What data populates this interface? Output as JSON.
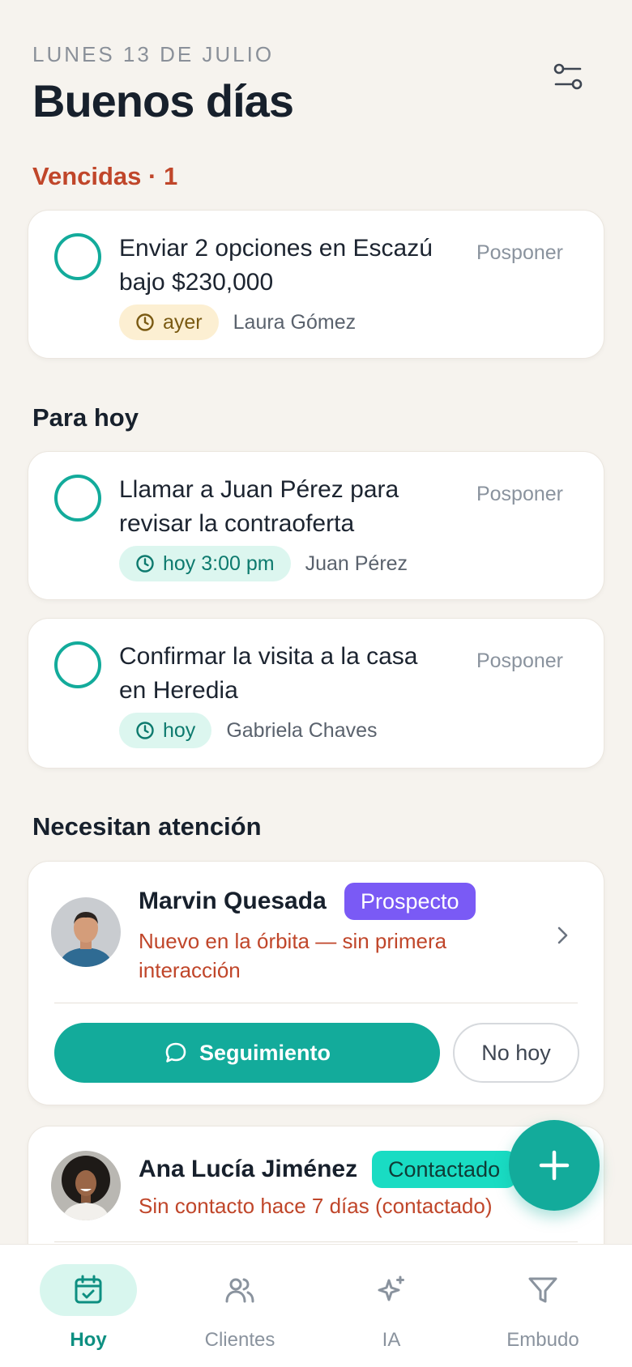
{
  "header": {
    "date": "LUNES 13 DE JULIO",
    "greeting": "Buenos días"
  },
  "overdue": {
    "title": "Vencidas · 1",
    "tasks": [
      {
        "title": "Enviar 2 opciones en Escazú bajo $230,000",
        "postpone": "Posponer",
        "due": "ayer",
        "client": "Laura Gómez"
      }
    ]
  },
  "today": {
    "title": "Para hoy",
    "tasks": [
      {
        "title": "Llamar a Juan Pérez para revisar la contraoferta",
        "postpone": "Posponer",
        "due": "hoy 3:00 pm",
        "client": "Juan Pérez"
      },
      {
        "title": "Confirmar la visita a la casa en Heredia",
        "postpone": "Posponer",
        "due": "hoy",
        "client": "Gabriela Chaves"
      }
    ]
  },
  "attention": {
    "title": "Necesitan atención",
    "leads": [
      {
        "name": "Marvin Quesada",
        "status": "Prospecto",
        "note": "Nuevo en la órbita — sin primera interacción",
        "followup": "Seguimiento",
        "dismiss": "No hoy"
      },
      {
        "name": "Ana Lucía Jiménez",
        "status": "Contactado",
        "note": "Sin contacto hace 7 días (contactado)"
      }
    ]
  },
  "nav": {
    "items": [
      {
        "label": "Hoy",
        "icon": "calendar-check-icon"
      },
      {
        "label": "Clientes",
        "icon": "users-icon"
      },
      {
        "label": "IA",
        "icon": "sparkles-icon"
      },
      {
        "label": "Embudo",
        "icon": "funnel-icon"
      }
    ]
  },
  "colors": {
    "accent": "#13ab9b",
    "overdue": "#c0462a",
    "prospect": "#7a5af5",
    "contacted": "#19dcc3",
    "background": "#f6f3ee"
  }
}
